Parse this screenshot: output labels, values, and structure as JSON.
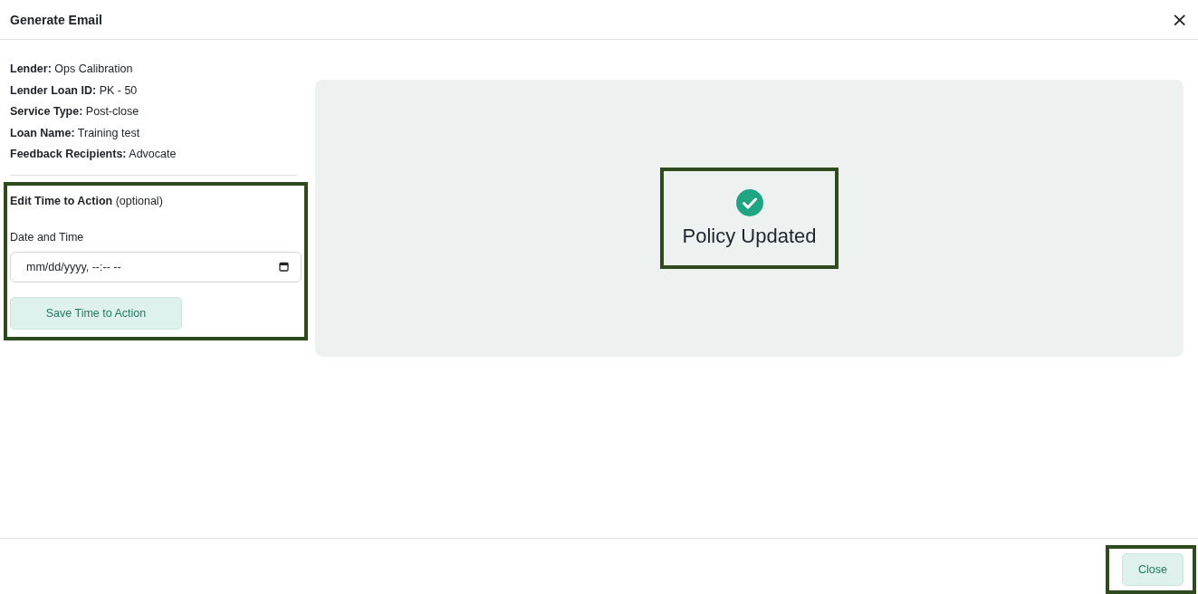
{
  "dialog": {
    "title": "Generate Email",
    "close_icon": "×"
  },
  "details": [
    "**Lender:** Ops Calibration",
    "**Lender Loan ID:** PK - 50",
    "**Service Type:** Post-close",
    "**Loan Name:** Training test",
    "**Feedback Recipients:** Advocate"
  ],
  "time_to_action": {
    "highlighted": true,
    "heading": "**Edit Time to Action** (optional)",
    "field_label": "Date and Time",
    "field": {
      "placeholder": "mm/dd/yyyy, --:-- --"
    },
    "button": "Save Time to Action"
  },
  "status": {
    "highlighted": true,
    "message": "Policy Updated"
  },
  "footer": {
    "button": {
      "label": "Close",
      "highlighted": true
    }
  }
}
